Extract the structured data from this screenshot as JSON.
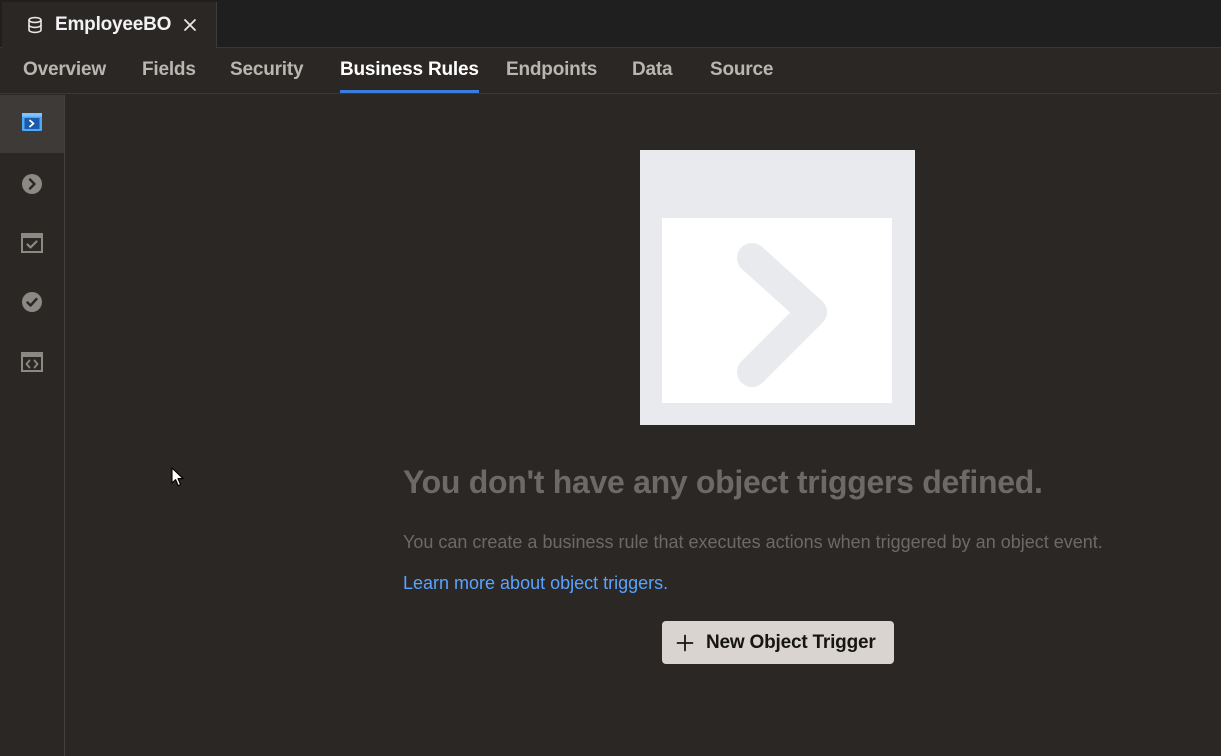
{
  "file_tab": {
    "label": "EmployeeBO",
    "icon": "database-icon"
  },
  "subnav": {
    "tabs": [
      {
        "label": "Overview"
      },
      {
        "label": "Fields"
      },
      {
        "label": "Security"
      },
      {
        "label": "Business Rules"
      },
      {
        "label": "Endpoints"
      },
      {
        "label": "Data"
      },
      {
        "label": "Source"
      }
    ],
    "active": "Business Rules"
  },
  "rail": {
    "items": [
      {
        "icon": "object-trigger-icon",
        "active": true
      },
      {
        "icon": "field-trigger-icon",
        "active": false
      },
      {
        "icon": "object-validator-icon",
        "active": false
      },
      {
        "icon": "field-validator-icon",
        "active": false
      },
      {
        "icon": "object-function-icon",
        "active": false
      }
    ]
  },
  "empty_state": {
    "title": "You don't have any object triggers defined.",
    "description": "You can create a business rule that executes actions when triggered by an object event.",
    "link_text": "Learn more about object triggers.",
    "button_label": "New Object Trigger",
    "illustration": "chevron-right-illustration"
  },
  "colors": {
    "accent": "#3b7ddd",
    "link": "#5aa3ff",
    "background": "#2a2725",
    "button_bg": "#d9d4cf"
  }
}
